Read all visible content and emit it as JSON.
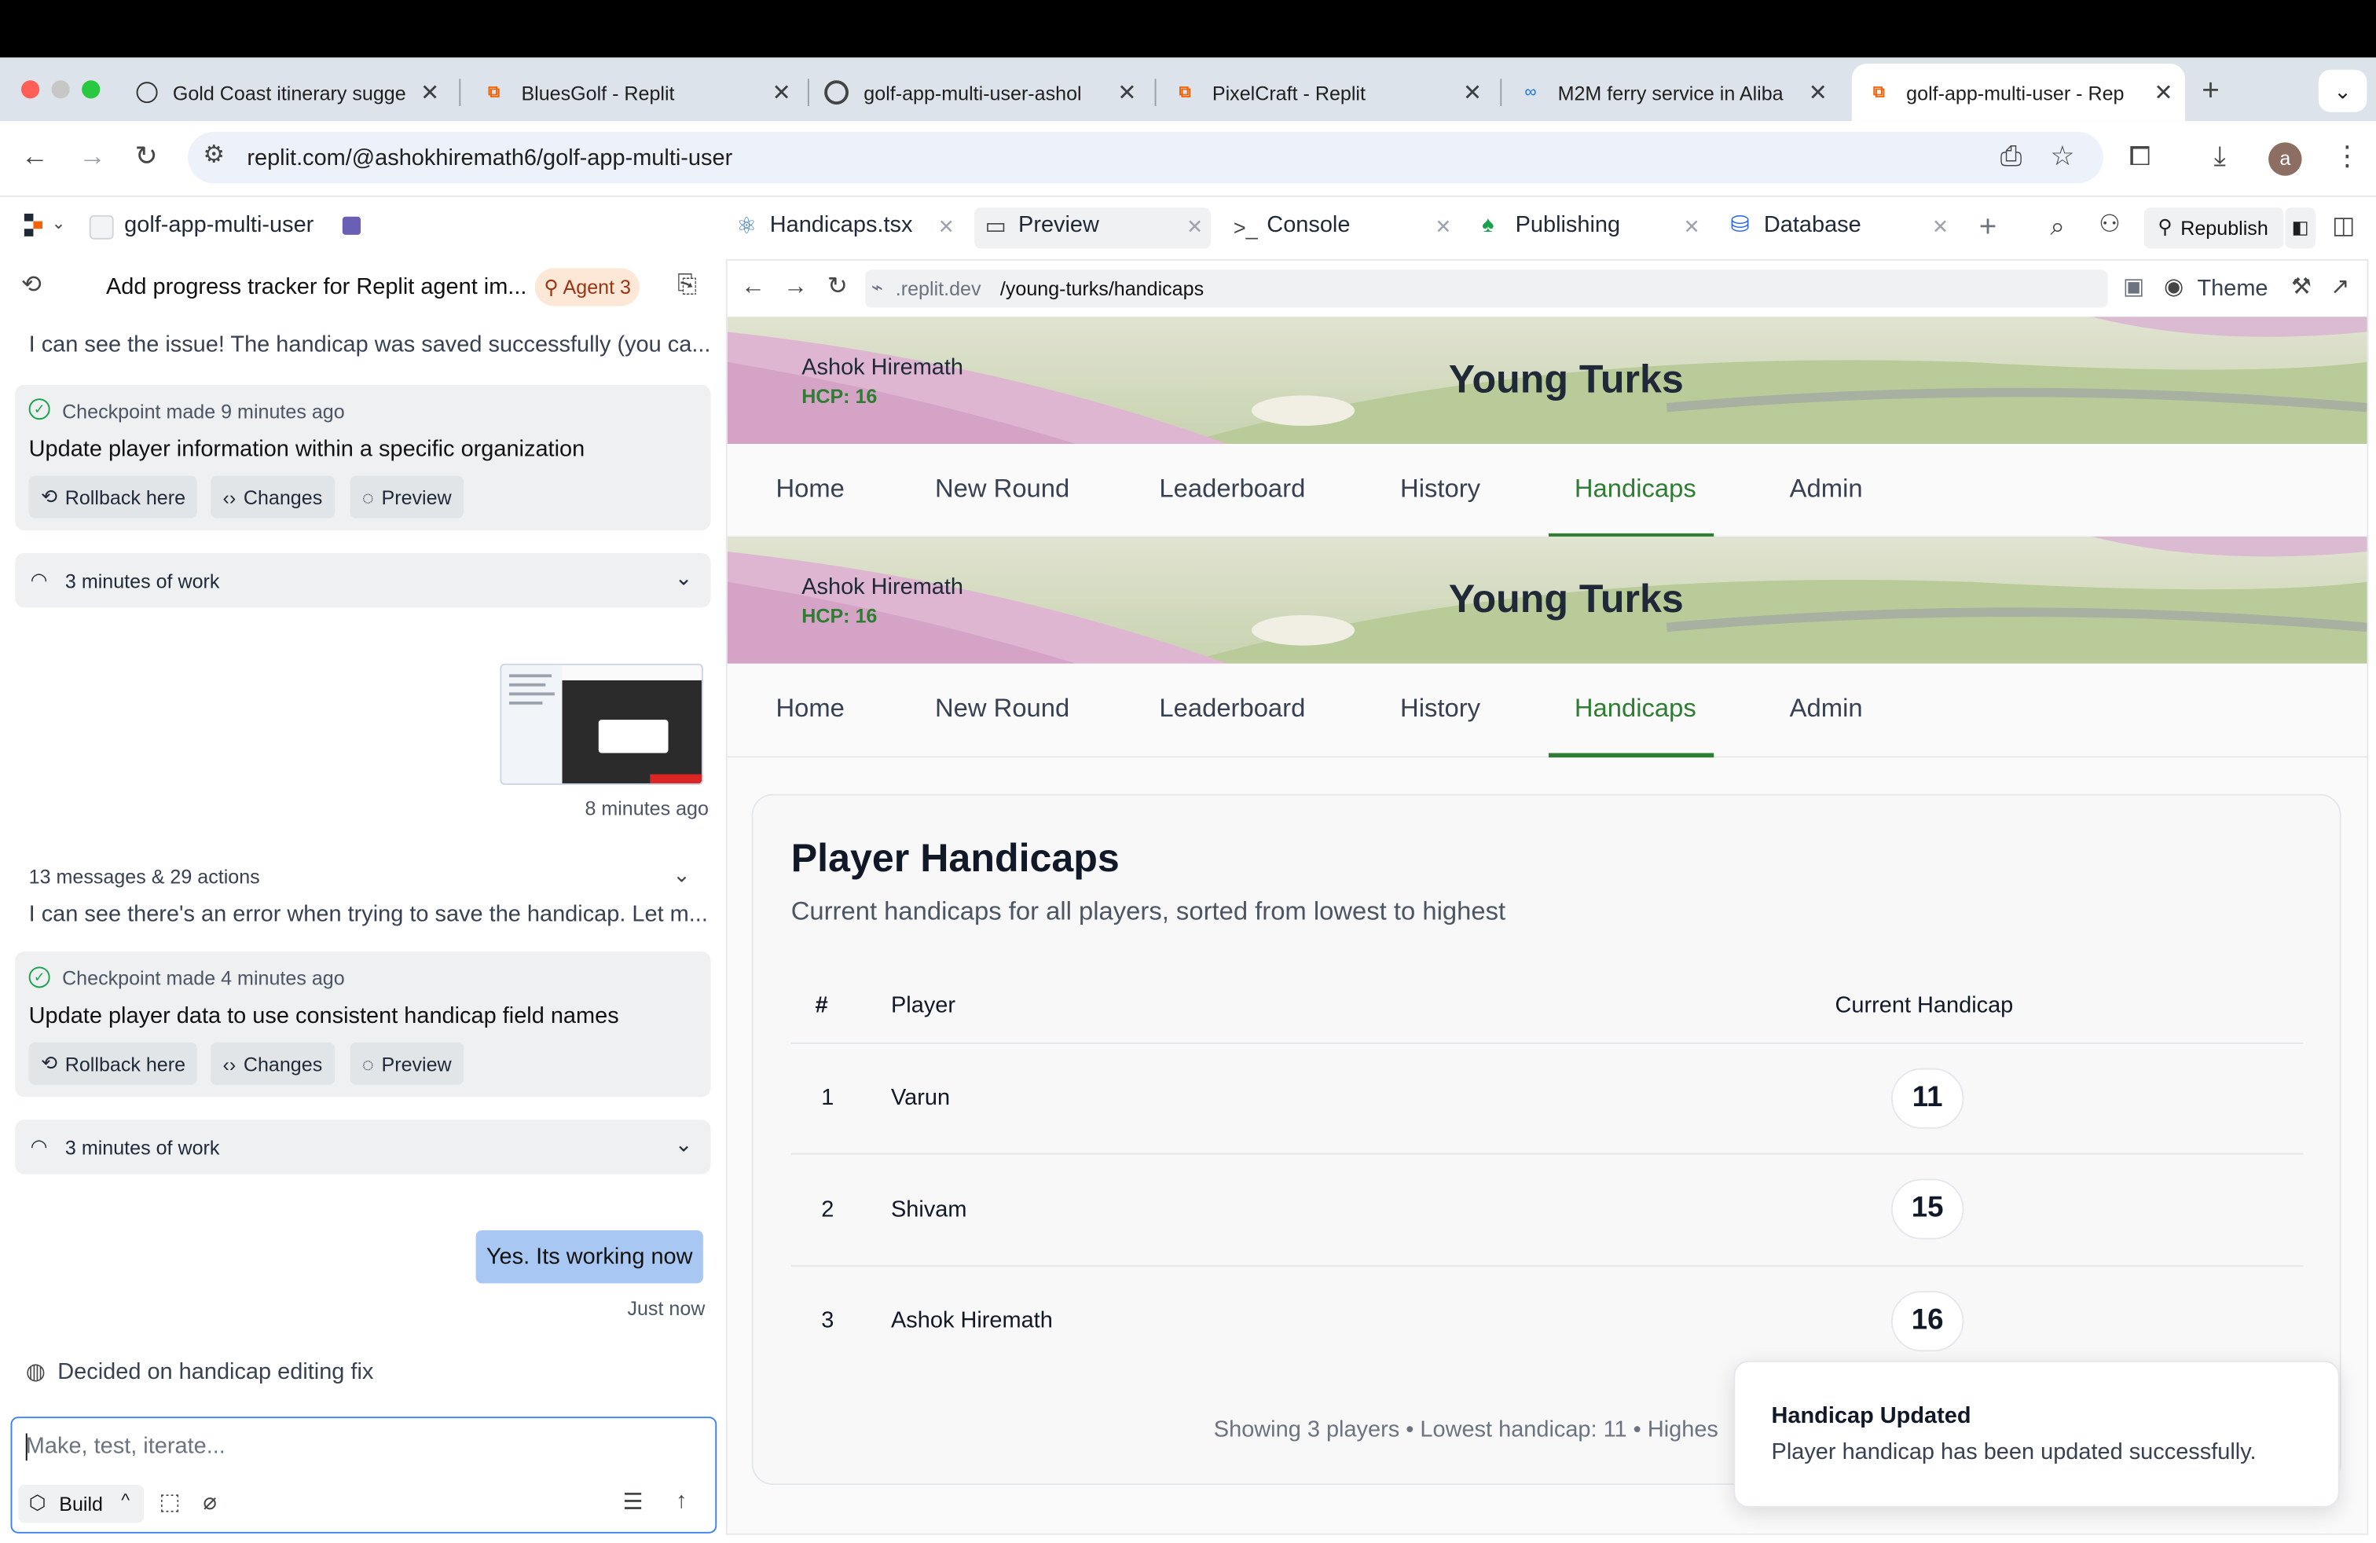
{
  "browser": {
    "tabs": [
      {
        "title": "Gold Coast itinerary sugge",
        "icon": "openai-icon"
      },
      {
        "title": "BluesGolf - Replit",
        "icon": "replit-icon"
      },
      {
        "title": "golf-app-multi-user-ashol",
        "icon": "globe-icon"
      },
      {
        "title": "PixelCraft - Replit",
        "icon": "replit-icon"
      },
      {
        "title": "M2M ferry service in Aliba",
        "icon": "link-icon"
      },
      {
        "title": "golf-app-multi-user - Rep",
        "icon": "replit-icon"
      }
    ],
    "url": "replit.com/@ashokhiremath6/golf-app-multi-user",
    "avatar_letter": "a"
  },
  "replit": {
    "project_name": "golf-app-multi-user",
    "tabs": {
      "handicaps_file": "Handicaps.tsx",
      "preview": "Preview",
      "console": "Console",
      "publishing": "Publishing",
      "database": "Database"
    },
    "republish": "Republish"
  },
  "chat": {
    "title": "Add progress tracker for Replit agent im...",
    "agent_badge": "Agent 3",
    "msg1": "I can see the issue! The handicap was saved successfully (you ca...",
    "checkpoint1_meta": "Checkpoint made 9 minutes ago",
    "checkpoint1_title": "Update player information within a specific organization",
    "rollback": "Rollback here",
    "changes": "Changes",
    "preview": "Preview",
    "work1": "3 minutes of work",
    "screenshot_time": "8 minutes ago",
    "summary": "13 messages & 29 actions",
    "msg2": "I can see there's an error when trying to save the handicap. Let m...",
    "checkpoint2_meta": "Checkpoint made 4 minutes ago",
    "checkpoint2_title": "Update player data to use consistent handicap field names",
    "work2": "3 minutes of work",
    "user_msg": "Yes. Its working now",
    "user_msg_time": "Just now",
    "decided": "Decided on handicap editing fix",
    "input_placeholder": "Make, test, iterate...",
    "build": "Build"
  },
  "preview_bar": {
    "url_prefix": ".replit.dev",
    "url_path": "/young-turks/handicaps",
    "theme": "Theme"
  },
  "app": {
    "user_name": "Ashok Hiremath",
    "user_hcp": "HCP: 16",
    "group_name": "Young Turks",
    "nav": [
      "Home",
      "New Round",
      "Leaderboard",
      "History",
      "Handicaps",
      "Admin"
    ],
    "page_title": "Player Handicaps",
    "page_subtitle": "Current handicaps for all players, sorted from lowest to highest",
    "columns": [
      "#",
      "Player",
      "Current Handicap"
    ],
    "rows": [
      {
        "rank": "1",
        "player": "Varun",
        "handicap": "11"
      },
      {
        "rank": "2",
        "player": "Shivam",
        "handicap": "15"
      },
      {
        "rank": "3",
        "player": "Ashok Hiremath",
        "handicap": "16"
      }
    ],
    "footer": "Showing 3 players • Lowest handicap: 11 • Highes"
  },
  "toast": {
    "title": "Handicap Updated",
    "message": "Player handicap has been updated successfully."
  }
}
